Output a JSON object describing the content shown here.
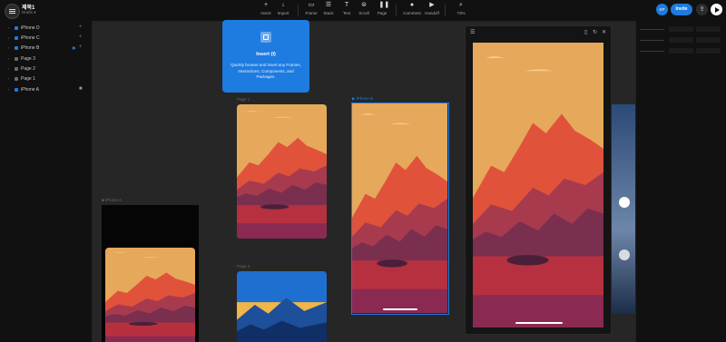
{
  "header": {
    "project_title": "제목1",
    "project_subtitle": "Drafts ▾",
    "tools": [
      {
        "label": "Insert",
        "icon": "plus-icon",
        "glyph": "+"
      },
      {
        "label": "Import",
        "icon": "import-icon",
        "glyph": "↓"
      },
      {
        "label": "Frame",
        "icon": "frame-icon",
        "glyph": "▭"
      },
      {
        "label": "Stack",
        "icon": "stack-icon",
        "glyph": "☰"
      },
      {
        "label": "Text",
        "icon": "text-icon",
        "glyph": "T"
      },
      {
        "label": "Scroll",
        "icon": "scroll-icon",
        "glyph": "⊜"
      },
      {
        "label": "Page",
        "icon": "page-icon",
        "glyph": "❚❚"
      },
      {
        "label": "Comment",
        "icon": "comment-icon",
        "glyph": "●"
      },
      {
        "label": "Handoff",
        "icon": "handoff-icon",
        "glyph": "▶"
      },
      {
        "label": "73%",
        "icon": "zoom-icon",
        "glyph": "⌕"
      }
    ],
    "avatar_initials": "KP",
    "invite_label": "Invite"
  },
  "layers": [
    {
      "name": "iPhone D",
      "color": "#1e7be0"
    },
    {
      "name": "iPhone C",
      "color": "#1e7be0"
    },
    {
      "name": "iPhone B",
      "color": "#1e7be0"
    },
    {
      "name": "Page 3",
      "color": "#6b6b6b"
    },
    {
      "name": "Page 2",
      "color": "#6b6b6b"
    },
    {
      "name": "Page 1",
      "color": "#6b6b6b"
    },
    {
      "name": "iPhone A",
      "color": "#1e7be0"
    }
  ],
  "canvas": {
    "labels": {
      "iphone_a": "iPhone A",
      "page1": "Page 1",
      "page2": "Page 2",
      "iphone_b": "iPhone B"
    }
  },
  "insert_tooltip": {
    "title": "Insert (I)",
    "description": "Quickly browse and insert any Frames, Interactions, Components, and Packages."
  },
  "colors": {
    "accent": "#1e7be0",
    "sky": "#e6a85a",
    "mountain_red": "#e0533a",
    "mountain_purple": "#7a2f4e",
    "water": "#b7303f"
  }
}
